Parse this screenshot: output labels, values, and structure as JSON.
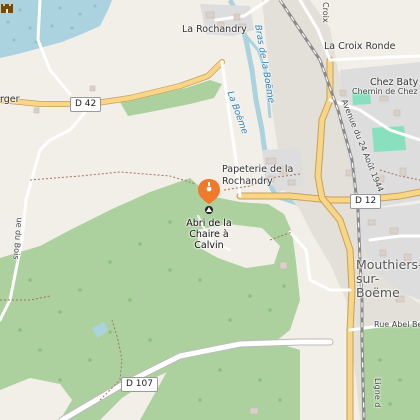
{
  "map": {
    "labels": {
      "la_rochandry": "La Rochandry",
      "croix": "Croix",
      "la_croix_ronde": "La Croix Ronde",
      "chez_baty": "Chez Baty",
      "chemin_de_chez": "Chemin de Chez",
      "avenue_24_aout": "Avenue du 24 Août 1944",
      "rue_abel_be": "Rue Abel Be",
      "bras_de_la_boeme": "Bras de la Boëme",
      "la_boeme": "La Boëme",
      "papeterie": "Papeterie de la Rochandry",
      "mouthiers": "Mouthiers-sur-Boëme",
      "ligne": "Ligne d",
      "rue_du_bois": "ue du Bois",
      "rger": "rger"
    },
    "roads": {
      "d42": "D 42",
      "d12": "D 12",
      "d107": "D 107"
    },
    "poi": {
      "name": "Abri de la Chaire à Calvin",
      "marker_color": "#f07a2c",
      "icon": "cave-icon"
    },
    "castle_icon": "castle-icon",
    "colors": {
      "land": "#f2efe9",
      "forest": "#add19e",
      "water": "#aad3df",
      "road_major": "#f9d587",
      "road_minor": "#ffffff",
      "residential": "#dddddd",
      "railway": "#8a8a8a",
      "pitch": "#88e0be"
    }
  }
}
